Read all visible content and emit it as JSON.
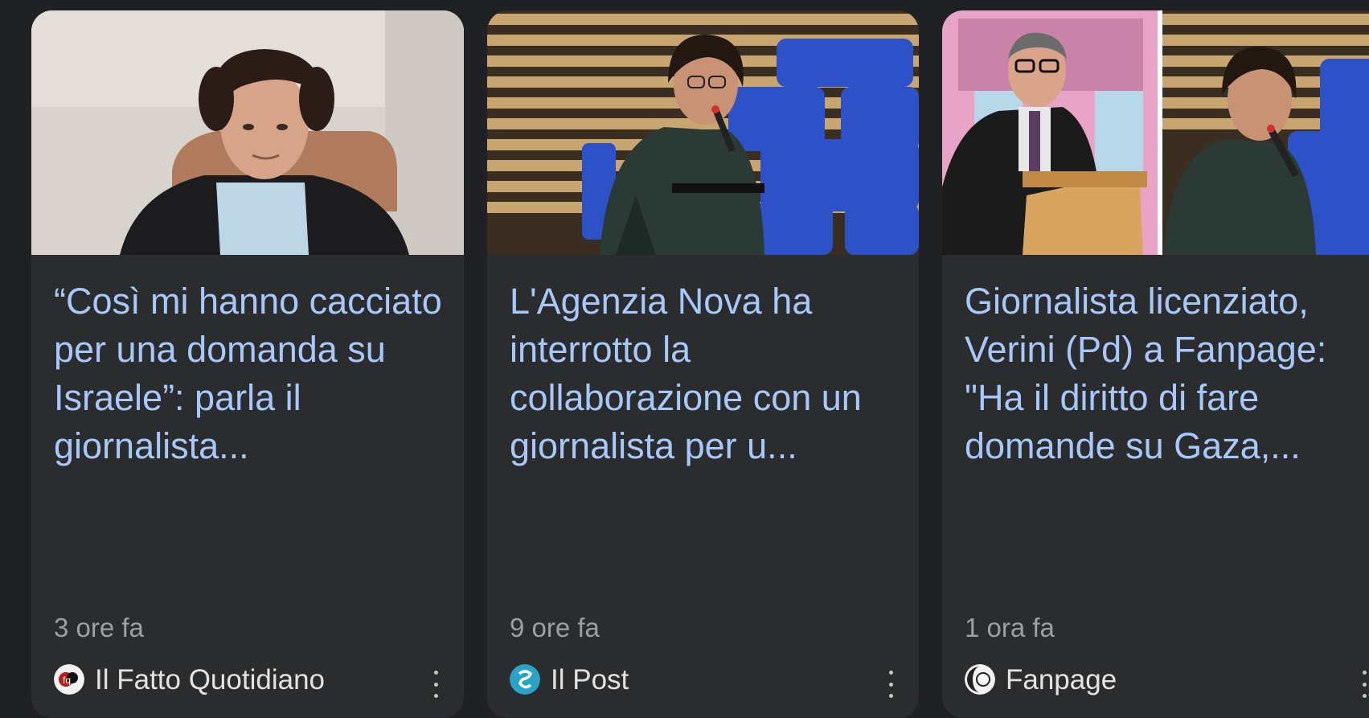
{
  "cards": [
    {
      "headline": "“Così mi hanno cacciato per una domanda su Israele”: parla il giornalista...",
      "time": "3 ore fa",
      "source": "Il Fatto Quotidiano",
      "source_icon": "fatto-quotidiano-logo",
      "image": "man-video-call-photo"
    },
    {
      "headline": "L'Agenzia Nova ha interrotto la collaborazione con un giornalista per u...",
      "time": "9 ore fa",
      "source": "Il Post",
      "source_icon": "il-post-logo",
      "image": "journalist-blue-seats-photo"
    },
    {
      "headline": "Giornalista licenziato, Verini (Pd) a Fanpage: \"Ha il diritto di fare domande su Gaza,...",
      "time": "1 ora fa",
      "source": "Fanpage",
      "source_icon": "fanpage-logo",
      "image": "politician-and-journalist-photo"
    }
  ],
  "colors": {
    "background": "#202124",
    "card": "#2b2c2e",
    "headline": "#a8c7fa",
    "meta": "#9aa0a6",
    "source": "#e3e3e3"
  }
}
